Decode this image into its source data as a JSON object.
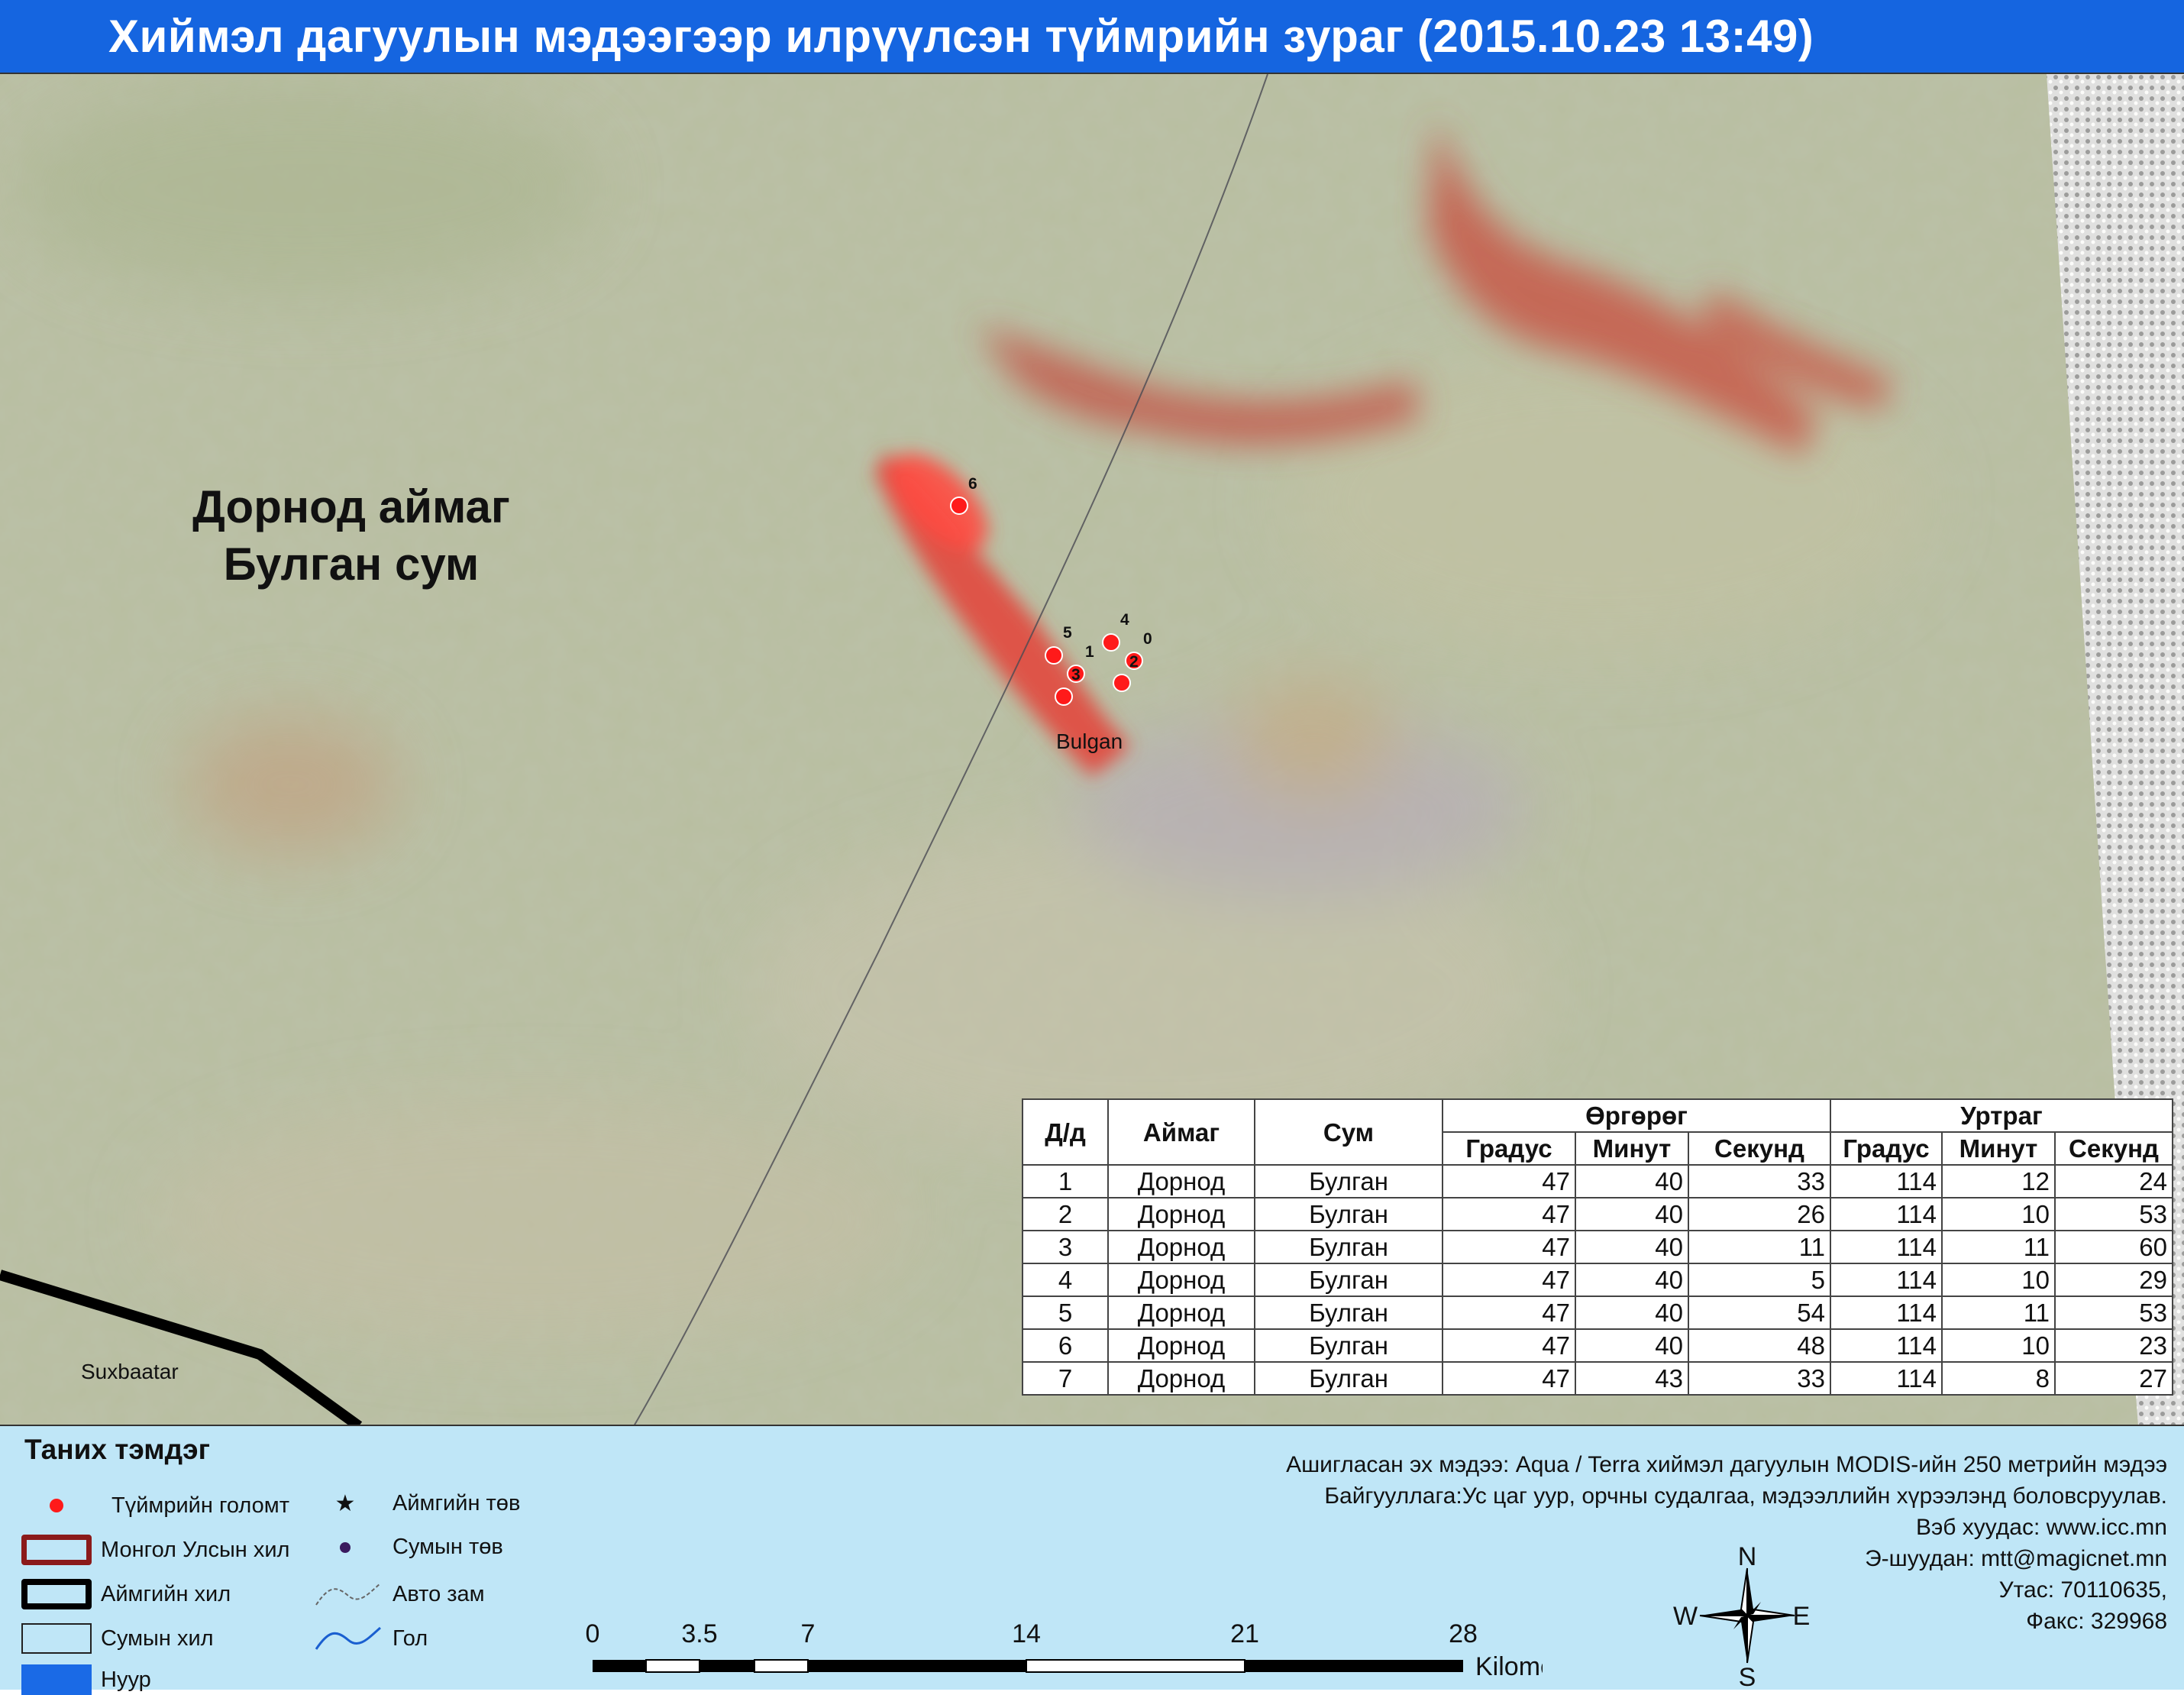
{
  "title": "Хиймэл дагуулын мэдээгээр илрүүлсэн түймрийн зураг  (2015.10.23 13:49)",
  "map": {
    "region_label_line1": "Дорнод  аймаг",
    "region_label_line2": "Булган сум",
    "place_bulgan": "Bulgan",
    "place_suxbaatar": "Suxbaatar",
    "fire_points": [
      {
        "label": "6"
      },
      {
        "label": "5"
      },
      {
        "label": "4"
      },
      {
        "label": "1"
      },
      {
        "label": "0"
      },
      {
        "label": "2"
      },
      {
        "label": "3"
      }
    ],
    "colors": {
      "fire": "#ff1a1a",
      "burn_scar": "#c8564a",
      "title_bar": "#1565e0"
    }
  },
  "table": {
    "headers": {
      "num": "Д/д",
      "aimag": "Аймаг",
      "sum": "Сум",
      "lat": "Өргөрөг",
      "lon": "Уртраг",
      "deg": "Градус",
      "min": "Минут",
      "sec": "Секунд"
    },
    "rows": [
      {
        "n": "1",
        "aimag": "Дорнод",
        "sum": "Булган",
        "lat_d": "47",
        "lat_m": "40",
        "lat_s": "33",
        "lon_d": "114",
        "lon_m": "12",
        "lon_s": "24"
      },
      {
        "n": "2",
        "aimag": "Дорнод",
        "sum": "Булган",
        "lat_d": "47",
        "lat_m": "40",
        "lat_s": "26",
        "lon_d": "114",
        "lon_m": "10",
        "lon_s": "53"
      },
      {
        "n": "3",
        "aimag": "Дорнод",
        "sum": "Булган",
        "lat_d": "47",
        "lat_m": "40",
        "lat_s": "11",
        "lon_d": "114",
        "lon_m": "11",
        "lon_s": "60"
      },
      {
        "n": "4",
        "aimag": "Дорнод",
        "sum": "Булган",
        "lat_d": "47",
        "lat_m": "40",
        "lat_s": "5",
        "lon_d": "114",
        "lon_m": "10",
        "lon_s": "29"
      },
      {
        "n": "5",
        "aimag": "Дорнод",
        "sum": "Булган",
        "lat_d": "47",
        "lat_m": "40",
        "lat_s": "54",
        "lon_d": "114",
        "lon_m": "11",
        "lon_s": "53"
      },
      {
        "n": "6",
        "aimag": "Дорнод",
        "sum": "Булган",
        "lat_d": "47",
        "lat_m": "40",
        "lat_s": "48",
        "lon_d": "114",
        "lon_m": "10",
        "lon_s": "23"
      },
      {
        "n": "7",
        "aimag": "Дорнод",
        "sum": "Булган",
        "lat_d": "47",
        "lat_m": "43",
        "lat_s": "33",
        "lon_d": "114",
        "lon_m": "8",
        "lon_s": "27"
      }
    ]
  },
  "legend": {
    "title": "Таних тэмдэг",
    "items": {
      "fire": "Түймрийн голомт",
      "national_border": "Монгол Улсын хил",
      "aimag_border": "Аймгийн хил",
      "sum_border": "Сумын хил",
      "lake": "Нуур",
      "aimag_center": "Аймгийн төв",
      "sum_center": "Сумын төв",
      "road": "Авто зам",
      "river": "Гол"
    }
  },
  "credits": {
    "line1": "Ашигласан эх мэдээ: Aqua / Terra хиймэл дагуулын MODIS-ийн 250 метрийн мэдээ",
    "line2": "Байгууллага:Ус цаг уур, орчны судалгаа, мэдээллийн хүрээлэнд боловсруулав.",
    "line3": "Вэб хуудас: www.icc.mn",
    "line4": "Э-шуудан: mtt@magicnet.mn",
    "line5": "Утас: 70110635,",
    "line6": "Факс: 329968"
  },
  "scale": {
    "ticks": [
      "0",
      "3.5",
      "7",
      "14",
      "21",
      "28"
    ],
    "unit": "Kilometers"
  },
  "compass": {
    "n": "N",
    "s": "S",
    "e": "E",
    "w": "W"
  }
}
